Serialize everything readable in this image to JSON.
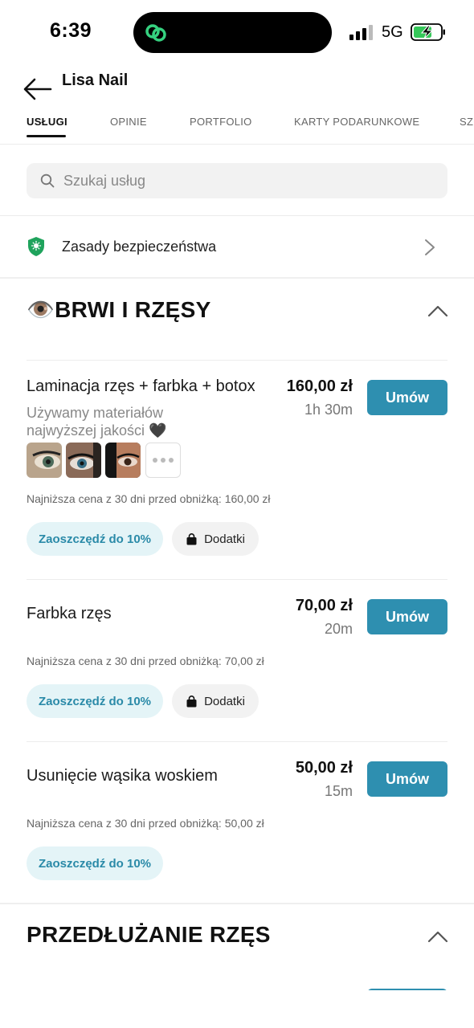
{
  "status_bar": {
    "time": "6:39",
    "network": "5G"
  },
  "header": {
    "title": "Lisa Nail"
  },
  "tabs": [
    {
      "label": "USŁUGI",
      "active": true
    },
    {
      "label": "OPINIE",
      "active": false
    },
    {
      "label": "PORTFOLIO",
      "active": false
    },
    {
      "label": "KARTY PODARUNKOWE",
      "active": false
    },
    {
      "label": "SZC",
      "active": false
    }
  ],
  "search": {
    "placeholder": "Szukaj usług"
  },
  "safety": {
    "label": "Zasady bezpieczeństwa"
  },
  "sections": [
    {
      "title": "👁️BRWI I RZĘSY",
      "services": [
        {
          "name": "Laminacja rzęs + farbka + botox",
          "price": "160,00 zł",
          "duration": "1h 30m",
          "description_line1": "Używamy materiałów",
          "description_line2": "najwyższej jakości",
          "description_emoji": "🖤",
          "lowest_price": "Najniższa cena z 30 dni przed obniżką: 160,00 zł",
          "save_label": "Zaoszczędź do 10%",
          "addons_label": "Dodatki",
          "book_label": "Umów"
        },
        {
          "name": "Farbka rzęs",
          "price": "70,00 zł",
          "duration": "20m",
          "lowest_price": "Najniższa cena z 30 dni przed obniżką: 70,00 zł",
          "save_label": "Zaoszczędź do 10%",
          "addons_label": "Dodatki",
          "book_label": "Umów"
        },
        {
          "name": "Usunięcie wąsika woskiem",
          "price": "50,00 zł",
          "duration": "15m",
          "lowest_price": "Najniższa cena z 30 dni przed obniżką: 50,00 zł",
          "save_label": "Zaoszczędź do 10%",
          "book_label": "Umów"
        }
      ]
    },
    {
      "title": "PRZEDŁUŻANIE RZĘS"
    }
  ],
  "icons": {
    "back": "arrow-left-icon",
    "search": "search-icon",
    "shield": "shield-icon",
    "chevron_right": "chevron-right-icon",
    "chevron_up": "chevron-up-icon",
    "bag": "bag-icon"
  },
  "colors": {
    "accent": "#2e8fb0",
    "save_pill_bg": "#e4f4f7",
    "save_pill_text": "#2a8aa8",
    "shield_green": "#1fa35c"
  }
}
